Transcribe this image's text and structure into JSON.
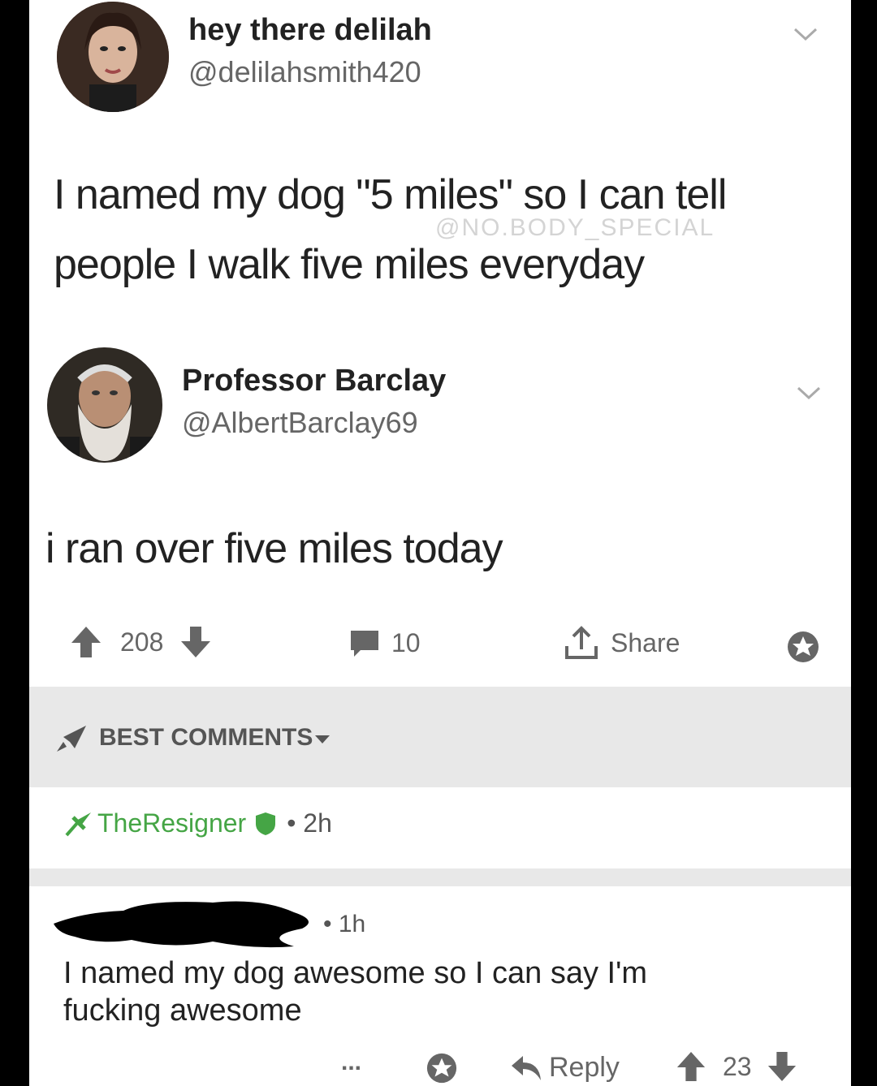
{
  "tweet1": {
    "display_name": "hey there delilah",
    "handle": "@delilahsmith420",
    "text_line1": "I named my dog \"5 miles\" so I can tell",
    "text_line2": "people I walk five miles everyday",
    "watermark": "@NO.BODY_SPECIAL"
  },
  "tweet2": {
    "display_name": "Professor Barclay",
    "handle": "@AlbertBarclay69",
    "text": "i ran over five miles today"
  },
  "post_actions": {
    "upvotes": "208",
    "comments": "10",
    "share_label": "Share"
  },
  "comments_header": {
    "label": "BEST COMMENTS"
  },
  "op_comment": {
    "username": "TheResigner",
    "time": "• 2h"
  },
  "reply": {
    "time": "• 1h",
    "text_line1": "I named my dog awesome so I can say I'm",
    "text_line2": "fucking awesome",
    "more": "...",
    "reply_label": "Reply",
    "upvotes": "23"
  },
  "colors": {
    "accent_green": "#45a545",
    "band_gray": "#e8e8e8"
  }
}
